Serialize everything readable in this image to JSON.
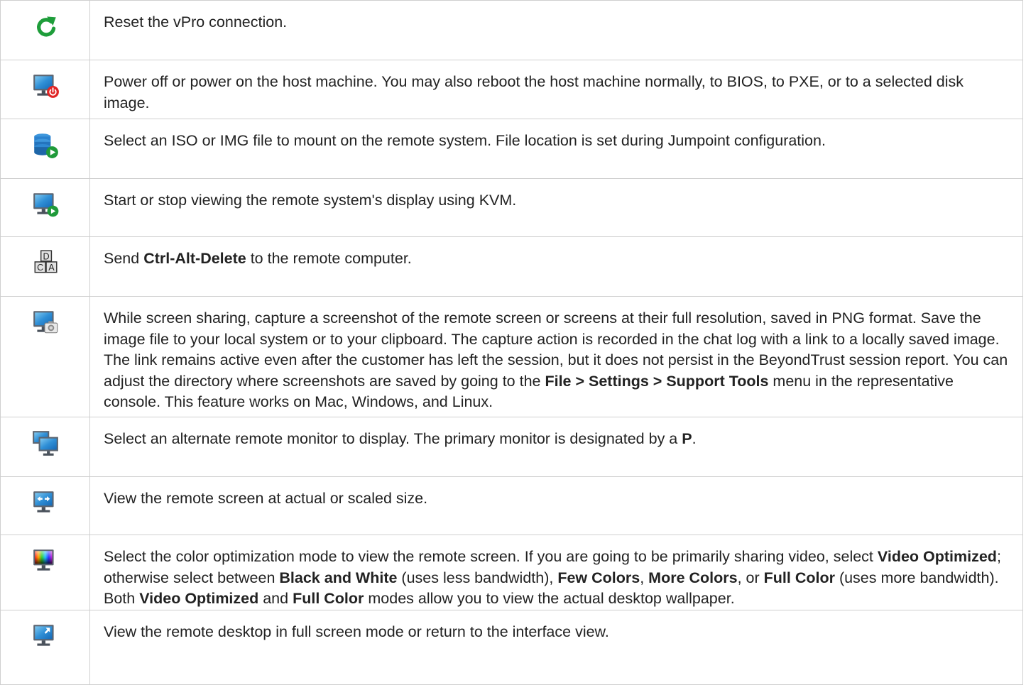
{
  "rows": [
    {
      "icon": "refresh-icon",
      "parts": [
        {
          "t": "Reset the vPro connection."
        }
      ]
    },
    {
      "icon": "monitor-power-icon",
      "parts": [
        {
          "t": "Power off or power on the host machine. You may also reboot the host machine normally, to BIOS, to PXE, or to a selected disk image."
        }
      ]
    },
    {
      "icon": "disk-image-play-icon",
      "parts": [
        {
          "t": "Select an ISO or IMG file to mount on the remote system. File location is set during Jumpoint configuration."
        }
      ]
    },
    {
      "icon": "monitor-play-icon",
      "parts": [
        {
          "t": "Start or stop viewing the remote system's display using KVM."
        }
      ]
    },
    {
      "icon": "ctrl-alt-delete-keys-icon",
      "key_labels": [
        "D",
        "C",
        "A"
      ],
      "parts": [
        {
          "t": "Send "
        },
        {
          "t": "Ctrl-Alt-Delete",
          "b": true
        },
        {
          "t": " to the remote computer."
        }
      ]
    },
    {
      "icon": "monitor-camera-icon",
      "parts": [
        {
          "t": "While screen sharing, capture a screenshot of the remote screen or screens at their full resolution, saved in PNG format. Save the image file to your local system or to your clipboard. The capture action is recorded in the chat log with a link to a locally saved image. The link remains active even after the customer has left the session, but it does not persist in the BeyondTrust session report. You can adjust the directory where screenshots are saved by going to the "
        },
        {
          "t": "File > Settings > Support Tools",
          "b": true
        },
        {
          "t": " menu in the representative console. This feature works on Mac, Windows, and Linux."
        }
      ]
    },
    {
      "icon": "multi-monitor-icon",
      "parts": [
        {
          "t": "Select an alternate remote monitor to display. The primary monitor is designated by a "
        },
        {
          "t": "P",
          "b": true
        },
        {
          "t": "."
        }
      ]
    },
    {
      "icon": "monitor-scale-arrows-icon",
      "parts": [
        {
          "t": "View the remote screen at actual or scaled size."
        }
      ]
    },
    {
      "icon": "monitor-color-icon",
      "parts": [
        {
          "t": "Select the color optimization mode to view the remote screen. If you are going to be primarily sharing video, select "
        },
        {
          "t": "Video Optimized",
          "b": true
        },
        {
          "t": "; otherwise select between "
        },
        {
          "t": "Black and White",
          "b": true
        },
        {
          "t": " (uses less bandwidth), "
        },
        {
          "t": "Few Colors",
          "b": true
        },
        {
          "t": ", "
        },
        {
          "t": "More Colors",
          "b": true
        },
        {
          "t": ", or "
        },
        {
          "t": "Full Color",
          "b": true
        },
        {
          "t": " (uses more bandwidth). Both "
        },
        {
          "t": "Video Optimized",
          "b": true
        },
        {
          "t": " and "
        },
        {
          "t": "Full Color",
          "b": true
        },
        {
          "t": " modes allow you to view the actual desktop wallpaper."
        }
      ]
    },
    {
      "icon": "monitor-fullscreen-icon",
      "parts": [
        {
          "t": "View the remote desktop in full screen mode or return to the interface view."
        }
      ]
    }
  ]
}
